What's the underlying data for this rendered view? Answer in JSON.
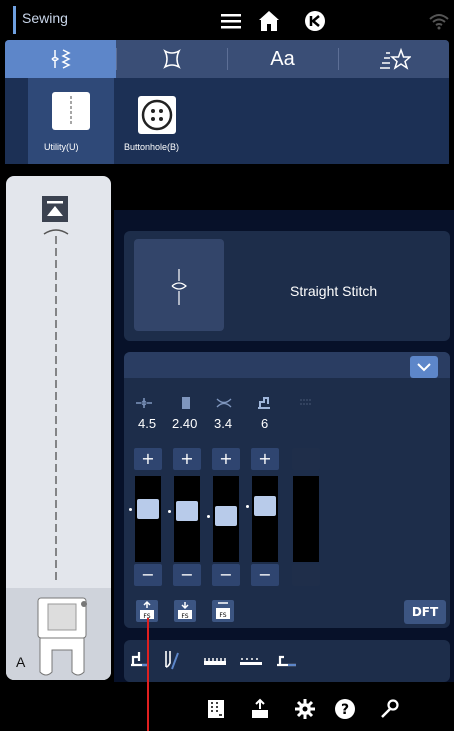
{
  "topbar": {
    "mode": "Sewing"
  },
  "tabs": [
    {
      "name": "utility-stitches-tab",
      "glyph": "⚲"
    },
    {
      "name": "decorative-stitches-tab",
      "glyph": "✂"
    },
    {
      "name": "letters-tab",
      "glyph": "Aa"
    },
    {
      "name": "favorites-tab",
      "glyph": "☆"
    }
  ],
  "categories": [
    {
      "label": "Utility(U)"
    },
    {
      "label": "Buttonhole(B)"
    }
  ],
  "foot": {
    "letter": "A"
  },
  "stitch": {
    "name": "Straight Stitch"
  },
  "params": [
    {
      "value": "4.5",
      "icon": "stitch-position-icon"
    },
    {
      "value": "2.40",
      "icon": "stitch-length-icon"
    },
    {
      "value": "3.4",
      "icon": "tension-icon"
    },
    {
      "value": "6",
      "icon": "foot-pressure-icon"
    },
    {
      "value": "",
      "icon": "disabled-param-icon"
    }
  ],
  "sliders": [
    {
      "level": 0.35
    },
    {
      "level": 0.38
    },
    {
      "level": 0.45
    },
    {
      "level": 0.3
    }
  ],
  "controls": {
    "plus": "+",
    "minus": "−",
    "dft": "DFT"
  },
  "colors": {
    "accent": "#5d86c9",
    "panel": "#1d2d4a",
    "pointer": "#e02020"
  }
}
